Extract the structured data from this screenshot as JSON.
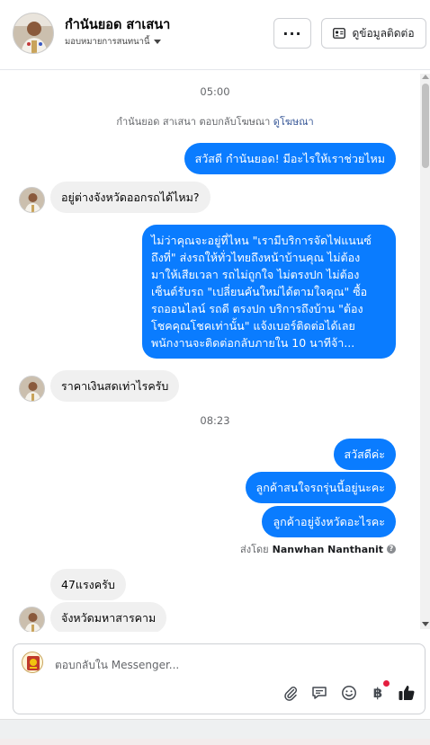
{
  "header": {
    "contact_name": "กำนันยอด สาเสนา",
    "assign_label": "มอบหมายการสนทนานี้",
    "more_label": "···",
    "contact_info_label": "ดูข้อมูลติดต่อ"
  },
  "thread": {
    "time_1": "05:00",
    "ad_reply_text": "กำนันยอด สาเสนา ตอบกลับโฆษณา",
    "ad_link": "ดูโฆษณา",
    "messages": [
      {
        "side": "out",
        "text": "สวัสดี กำนันยอด! มีอะไรให้เราช่วยไหม"
      },
      {
        "side": "in",
        "text": "อยู่ต่างจังหวัดออกรถได้ไหม?"
      },
      {
        "side": "out",
        "text": "ไม่ว่าคุณจะอยู่ที่ไหน \"เรามีบริการจัดไฟแนนซ์\nถึงที่\"  ส่งรถให้ทั่วไทยถึงหน้าบ้านคุณ ไม่ต้อง\nมาให้เสียเวลา รถไม่ถูกใจ ไม่ตรงปก ไม่ต้อง\nเซ็นต์รับรถ \"เปลี่ยนคันใหม่ได้ตามใจคุณ\" ซื้อ\nรถออนไลน์ รถดี ตรงปก บริการถึงบ้าน \"ต้อง\nโชคคุณโชคเท่านั้น\" แจ้งเบอร์ติดต่อได้เลย\nพนักงานจะติดต่อกลับภายใน 10 นาทีจ้า..."
      },
      {
        "side": "in",
        "text": "ราคาเงินสดเท่าไรครับ"
      },
      {
        "side": "out",
        "text": "สวัสดีค่ะ"
      },
      {
        "side": "out",
        "text": "ลูกค้าสนใจรถรุ่นนี้อยู่นะคะ"
      },
      {
        "side": "out",
        "text": "ลูกค้าอยู่จังหวัดอะไรคะ"
      },
      {
        "side": "in",
        "text": "47แรงครับ"
      },
      {
        "side": "in",
        "text": "จังหวัดมหาสารคาม"
      }
    ],
    "time_2": "08:23",
    "sent_by_prefix": "ส่งโดย",
    "sent_by_name": "Nanwhan Nanthanit"
  },
  "composer": {
    "placeholder": "ตอบกลับใน Messenger...",
    "value": "",
    "icons": [
      "paperclip-icon",
      "saved-reply-icon",
      "emoji-icon",
      "payment-icon",
      "like-icon"
    ],
    "colors": {
      "accent": "#0a7cff",
      "notification_dot": "#e41e3f"
    }
  }
}
